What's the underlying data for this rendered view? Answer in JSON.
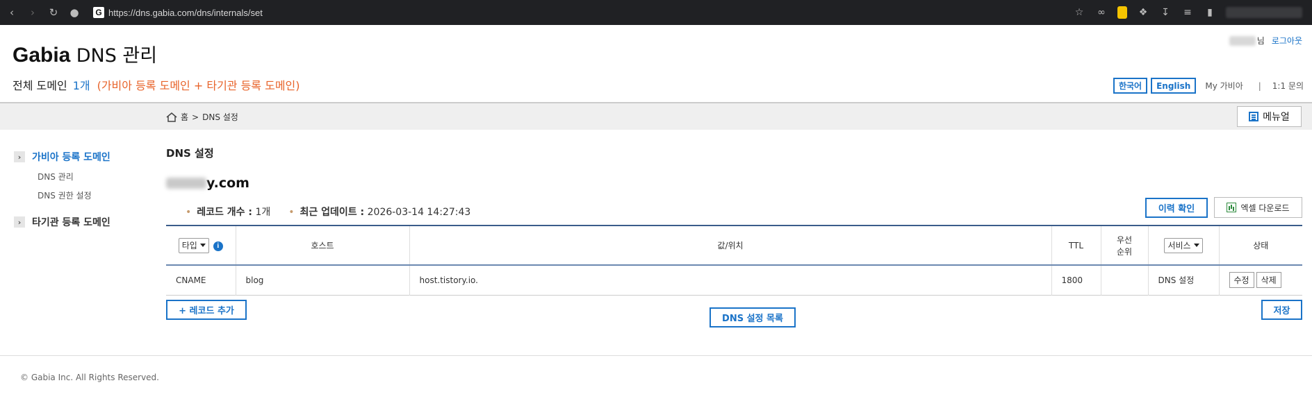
{
  "browser": {
    "url": "https://dns.gabia.com/dns/internals/set",
    "site_icon": "G"
  },
  "header": {
    "brand_bold": "Gabia",
    "brand_light": "DNS 관리",
    "summary_label": "전체 도메인",
    "summary_count": "1개",
    "summary_note": "(가비아 등록 도메인 + 타기관 등록 도메인)",
    "user_suffix": "님",
    "logout": "로그아웃",
    "lang_ko": "한국어",
    "lang_en": "English",
    "my_gabia": "My 가비아",
    "separator": "|",
    "inquiry": "1:1 문의"
  },
  "breadcrumb": {
    "home": "홈",
    "sep": ">",
    "current": "DNS 설정",
    "manual": "메뉴얼"
  },
  "sidebar": {
    "group1": "가비아 등록 도메인",
    "sub1": "DNS 관리",
    "sub2": "DNS 권한 설정",
    "group2": "타기관 등록 도메인"
  },
  "main": {
    "title": "DNS 설정",
    "domain_suffix": "y.com",
    "record_count_label": "레코드 개수 :",
    "record_count": "1개",
    "last_update_label": "최근 업데이트 :",
    "last_update": "2026-03-14 14:27:43",
    "history_button": "이력 확인",
    "excel_button": "엑셀 다운로드",
    "table": {
      "col_type": "타입",
      "col_host": "호스트",
      "col_value": "값/위치",
      "col_ttl": "TTL",
      "col_priority_1": "우선",
      "col_priority_2": "순위",
      "col_service": "서비스",
      "col_status": "상태",
      "rows": [
        {
          "type": "CNAME",
          "host": "blog",
          "value": "host.tistory.io.",
          "ttl": "1800",
          "priority": "",
          "service": "DNS 설정",
          "edit": "수정",
          "delete": "삭제"
        }
      ]
    },
    "add_button": "+ 레코드 추가",
    "list_button": "DNS 설정 목록",
    "save_button": "저장"
  },
  "footer": {
    "copyright": "© Gabia Inc. All Rights Reserved."
  }
}
